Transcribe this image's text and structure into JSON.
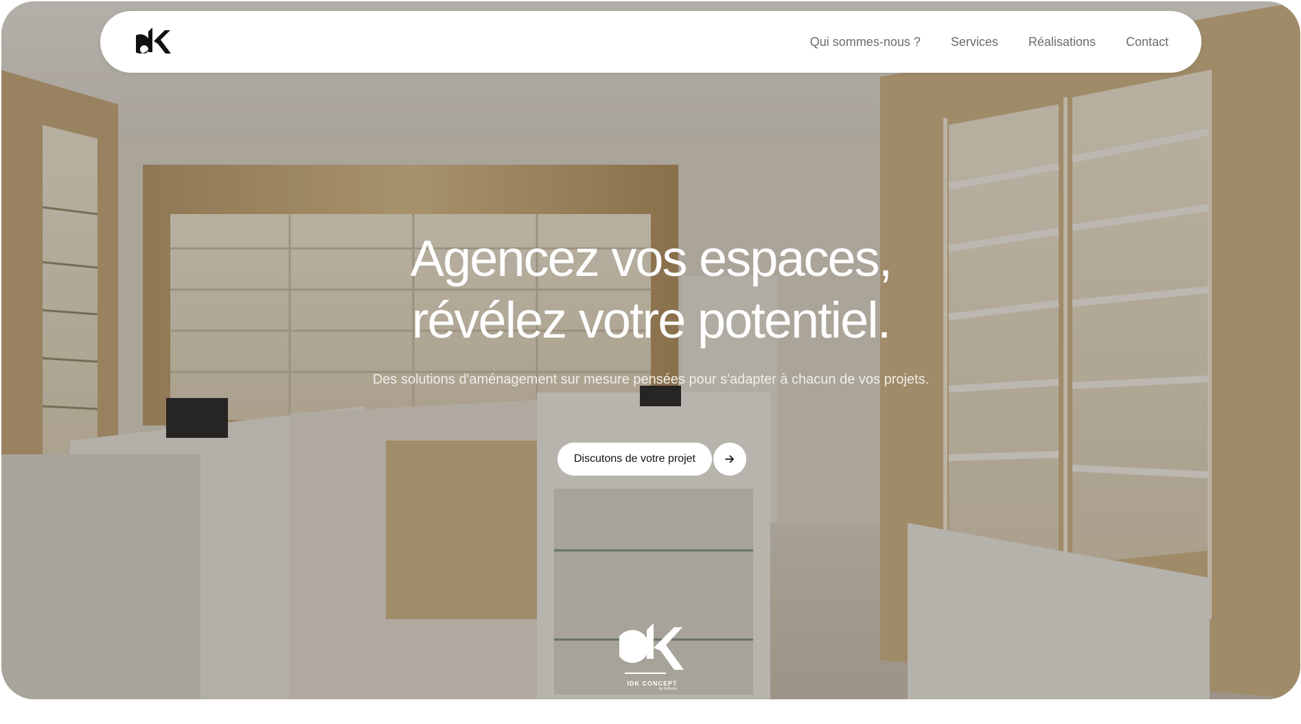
{
  "navbar": {
    "logo_icon": "dk-logo-icon",
    "links": [
      {
        "label": "Qui sommes-nous ?"
      },
      {
        "label": "Services"
      },
      {
        "label": "Réalisations"
      },
      {
        "label": "Contact"
      }
    ]
  },
  "hero": {
    "headline_line1": "Agencez vos espaces,",
    "headline_line2": "révélez votre potentiel.",
    "subtitle": "Des solutions d'aménagement sur mesure pensées pour s'adapter à chacun de vos projets.",
    "cta_label": "Discutons de votre projet",
    "cta_icon": "arrow-right-icon"
  },
  "footer_logo": {
    "name": "IDK CONCEPT",
    "tagline": "by Kellinma"
  },
  "colors": {
    "accent_wood": "#c9a96e",
    "white": "#ffffff",
    "nav_text": "#6b6b6b"
  }
}
